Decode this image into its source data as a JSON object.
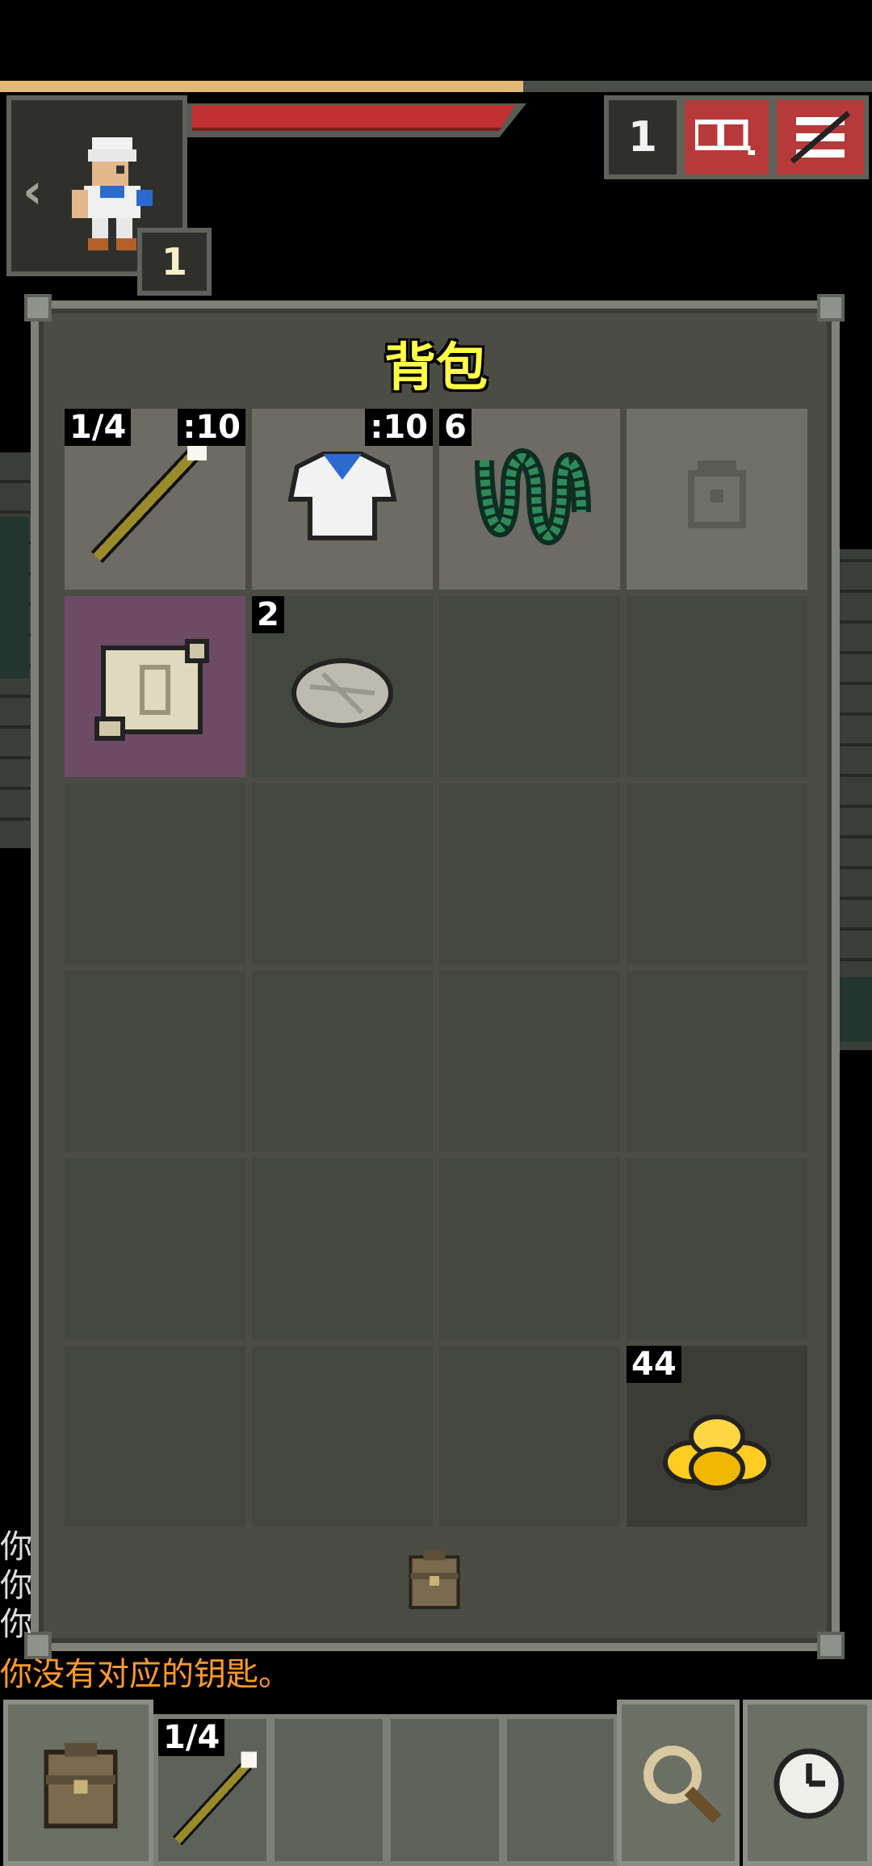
{
  "hud": {
    "xp_progress": 0.6,
    "hp_progress": 1.0,
    "level": "1",
    "depth": "1",
    "colors": {
      "xp": "#e2b877",
      "hp": "#c23030",
      "button_red": "#b8393a"
    }
  },
  "backpack": {
    "title": "背包",
    "slots": [
      {
        "item": "magic-wand",
        "badge_left": "1/4",
        "badge_right": ":10",
        "state": "equipped"
      },
      {
        "item": "cloth-armor",
        "badge_right": ":10",
        "state": "equipped"
      },
      {
        "item": "green-ring",
        "badge_left": "6",
        "state": "equipped"
      },
      {
        "item": "empty-misc-slot",
        "state": "equipped"
      },
      {
        "item": "scroll",
        "state": "highlight"
      },
      {
        "item": "bread-ration",
        "badge_left": "2",
        "state": "normal"
      },
      {
        "item": "gold",
        "badge_left": "44",
        "state": "dark"
      }
    ]
  },
  "log": {
    "lines": [
      "你",
      "你",
      "你"
    ],
    "warning": "你没有对应的钥匙。"
  },
  "toolbar": {
    "quickslot_badge": "1/4"
  }
}
